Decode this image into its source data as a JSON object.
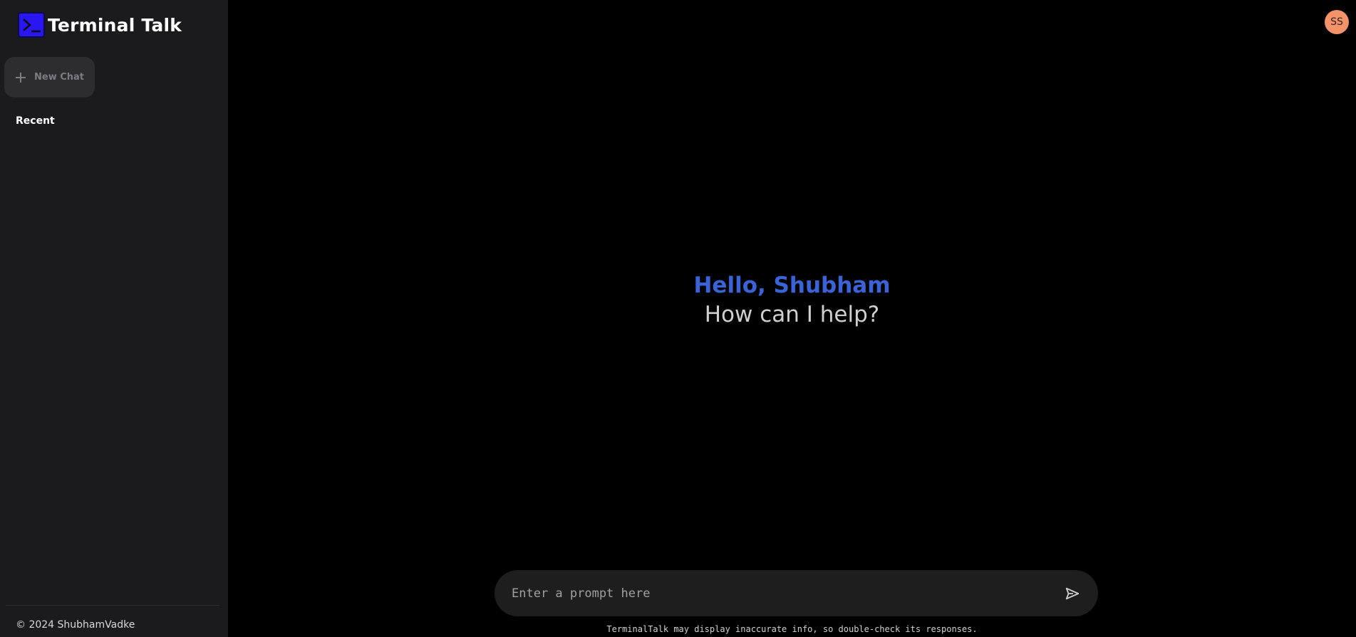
{
  "app": {
    "name": "Terminal Talk"
  },
  "sidebar": {
    "new_chat_label": "New Chat",
    "recent_heading": "Recent",
    "footer": "© 2024 ShubhamVadke"
  },
  "user": {
    "initials": "SS",
    "avatar_color": "#f2936a"
  },
  "greeting": {
    "hello": "Hello, Shubham",
    "prompt": "How can I help?"
  },
  "prompt": {
    "placeholder": "Enter a prompt here",
    "value": ""
  },
  "disclaimer": "TerminalTalk may display inaccurate info, so double-check its responses.",
  "icons": {
    "logo": "terminal-icon",
    "new_chat": "plus-icon",
    "send": "send-icon"
  },
  "colors": {
    "sidebar_bg": "#1b1b1d",
    "main_bg": "#000000",
    "accent": "#3a63d8",
    "logo_bg": "#2a16f0"
  }
}
